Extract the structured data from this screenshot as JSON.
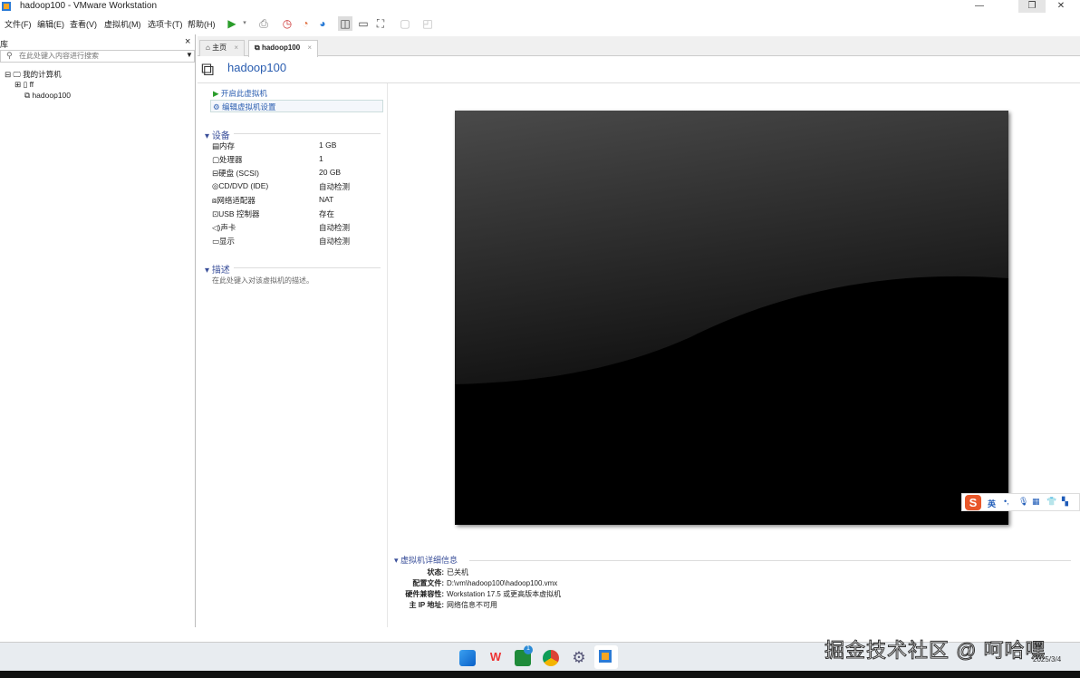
{
  "window": {
    "title": "hadoop100 - VMware Workstation",
    "minimize": "—",
    "restore": "❐",
    "close": "✕"
  },
  "menu": [
    "文件(F)",
    "编辑(E)",
    "查看(V)",
    "虚拟机(M)",
    "选项卡(T)",
    "帮助(H)"
  ],
  "library": {
    "title": "库",
    "close": "×",
    "search_placeholder": "在此处键入内容进行搜索",
    "tree": {
      "root": "我的计算机",
      "items": [
        "ff",
        "hadoop100"
      ]
    }
  },
  "tabs": [
    {
      "label": "主页"
    },
    {
      "label": "hadoop100"
    }
  ],
  "vm": {
    "name": "hadoop100",
    "actions": [
      "开启此虚拟机",
      "编辑虚拟机设置"
    ],
    "devices_title": "设备",
    "devices": [
      {
        "name": "内存",
        "value": "1 GB"
      },
      {
        "name": "处理器",
        "value": "1"
      },
      {
        "name": "硬盘 (SCSI)",
        "value": "20 GB"
      },
      {
        "name": "CD/DVD (IDE)",
        "value": "自动检测"
      },
      {
        "name": "网络适配器",
        "value": "NAT"
      },
      {
        "name": "USB 控制器",
        "value": "存在"
      },
      {
        "name": "声卡",
        "value": "自动检测"
      },
      {
        "name": "显示",
        "value": "自动检测"
      }
    ],
    "desc_title": "描述",
    "desc_placeholder": "在此处键入对该虚拟机的描述。",
    "details_title": "虚拟机详细信息",
    "details": [
      {
        "label": "状态:",
        "value": "已关机"
      },
      {
        "label": "配置文件:",
        "value": "D:\\vm\\hadoop100\\hadoop100.vmx"
      },
      {
        "label": "硬件兼容性:",
        "value": "Workstation 17.5 或更高版本虚拟机"
      },
      {
        "label": "主 IP 地址:",
        "value": "网络信息不可用"
      }
    ]
  },
  "ime": {
    "logo": "S",
    "lang": "英"
  },
  "taskbar": {
    "badge": "1",
    "date": "2025/3/4"
  },
  "watermark": "掘金技术社区 @ 呵哈嘿"
}
